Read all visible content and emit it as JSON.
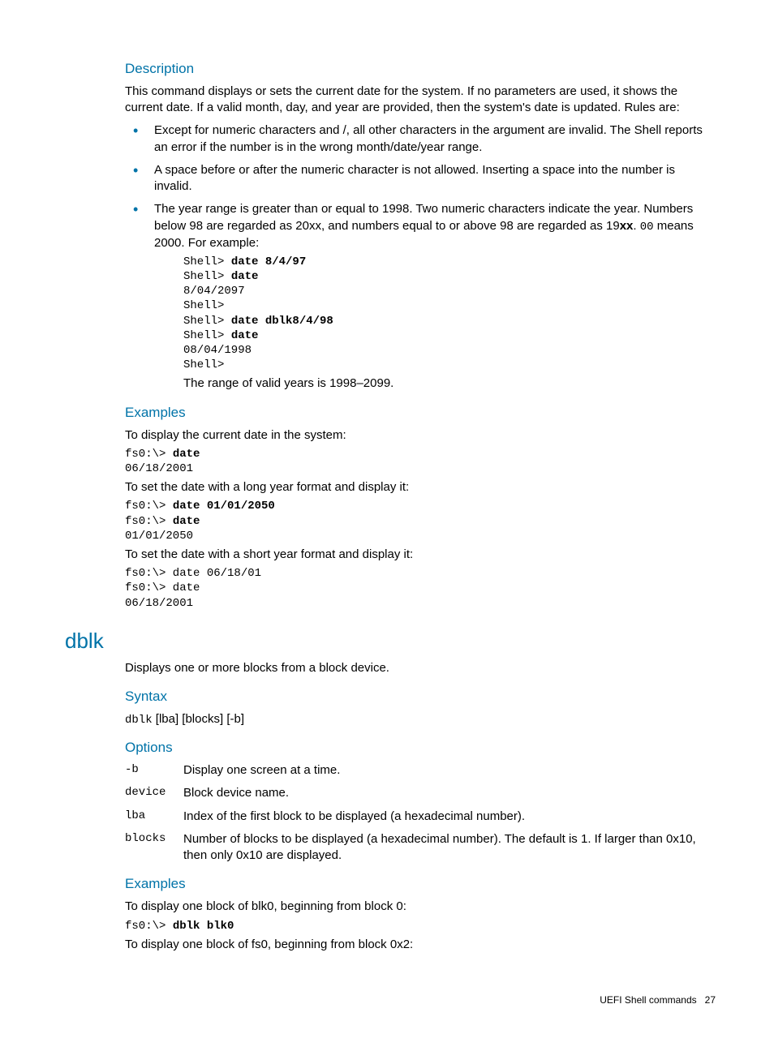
{
  "description": {
    "heading": "Description",
    "intro": "This command displays or sets the current date for the system. If no parameters are used, it shows the current date. If a valid month, day, and year are provided, then the system's date is updated. Rules are:",
    "bullet1": "Except for numeric characters and /, all other characters in the argument are invalid. The Shell reports an error if the number is in the wrong month/date/year range.",
    "bullet2": "A space before or after the numeric character is not allowed. Inserting a space into the number is invalid.",
    "bullet3_pre": "The year range is greater than or equal to 1998. Two numeric characters indicate the year. Numbers below 98 are regarded as 20xx, and numbers equal to or above 98 are regarded as 19",
    "bullet3_bold": "xx",
    "bullet3_mid": ". ",
    "bullet3_code": "00",
    "bullet3_post": " means 2000. For example:",
    "code1_l1_a": "Shell> ",
    "code1_l1_b": "date 8/4/97",
    "code1_l2_a": "Shell> ",
    "code1_l2_b": "date",
    "code1_l3": "8/04/2097",
    "code1_l4": "Shell>",
    "code1_l5_a": "Shell> ",
    "code1_l5_b": "date dblk8/4/98",
    "code1_l6_a": "Shell> ",
    "code1_l6_b": "date",
    "code1_l7": "08/04/1998",
    "code1_l8": "Shell>",
    "range_note": "The range of valid years is 1998–2099."
  },
  "examples1": {
    "heading": "Examples",
    "p1": "To display the current date in the system:",
    "c1_a": "fs0:\\> ",
    "c1_b": "date",
    "c1_l2": "06/18/2001",
    "p2": "To set the date with a long year format and display it:",
    "c2_a": "fs0:\\> ",
    "c2_b": "date 01/01/2050",
    "c2_l2a": "fs0:\\> ",
    "c2_l2b": "date",
    "c2_l3": "01/01/2050",
    "p3": "To set the date with a short year format and display it:",
    "c3_l1": "fs0:\\> date 06/18/01",
    "c3_l2": "fs0:\\> date",
    "c3_l3": "06/18/2001"
  },
  "dblk": {
    "title": "dblk",
    "summary": "Displays one or more blocks from a block device.",
    "syntax_heading": "Syntax",
    "syntax_cmd": "dblk",
    "syntax_rest": " [lba] [blocks] [-b]",
    "options_heading": "Options",
    "opt1_k": "-b",
    "opt1_v": "Display one screen at a time.",
    "opt2_k": "device",
    "opt2_v": "Block device name.",
    "opt3_k": "lba",
    "opt3_v": "Index of the first block to be displayed (a hexadecimal number).",
    "opt4_k": "blocks",
    "opt4_v": "Number of blocks to be displayed (a hexadecimal number). The default is 1. If larger than 0x10, then only 0x10 are displayed.",
    "examples_heading": "Examples",
    "ex_p1": "To display one block of blk0, beginning from block 0:",
    "ex_c1_a": "fs0:\\> ",
    "ex_c1_b": "dblk blk0",
    "ex_p2": "To display one block of fs0, beginning from block 0x2:"
  },
  "footer": {
    "label": "UEFI Shell commands",
    "page": "27"
  }
}
